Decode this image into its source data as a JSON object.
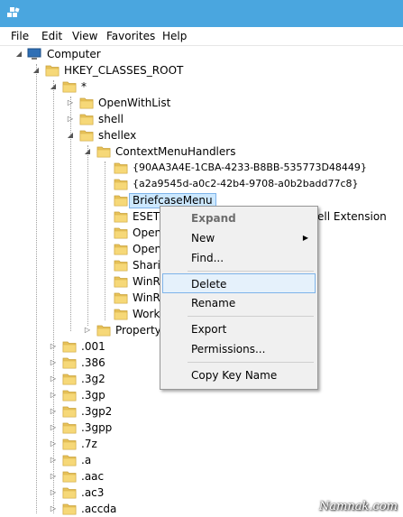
{
  "menu": [
    "File",
    "Edit",
    "View",
    "Favorites",
    "Help"
  ],
  "tree": {
    "computer": "Computer",
    "hkcr": "HKEY_CLASSES_ROOT",
    "star": "*",
    "openwithlist": "OpenWithList",
    "shell": "shell",
    "shellex": "shellex",
    "contextmenuhandlers": "ContextMenuHandlers",
    "guid1": "{90AA3A4E-1CBA-4233-B8BB-535773D48449}",
    "guid2": "{a2a9545d-a0c2-42b4-9708-a0b2badd77c8}",
    "briefcase": "BriefcaseMenu",
    "eset": "ESET S",
    "eset_tail": "ell Extension",
    "open1": "Open",
    "open2": "Open",
    "sharing": "Sharin",
    "winrar1": "WinRA",
    "winrar2": "WinRA",
    "workfolders": "Workf",
    "propertysheet": "PropertyS",
    "ext": [
      ".001",
      ".386",
      ".3g2",
      ".3gp",
      ".3gp2",
      ".3gpp",
      ".7z",
      ".a",
      ".aac",
      ".ac3",
      ".accda"
    ]
  },
  "context_menu": {
    "expand": "Expand",
    "new": "New",
    "find": "Find...",
    "delete": "Delete",
    "rename": "Rename",
    "export": "Export",
    "permissions": "Permissions...",
    "copy_key_name": "Copy Key Name"
  },
  "watermark": "Namnak.com",
  "colors": {
    "titlebar": "#4aa6df",
    "selection": "#cce8ff",
    "highlight_border": "#7eb4ea"
  }
}
